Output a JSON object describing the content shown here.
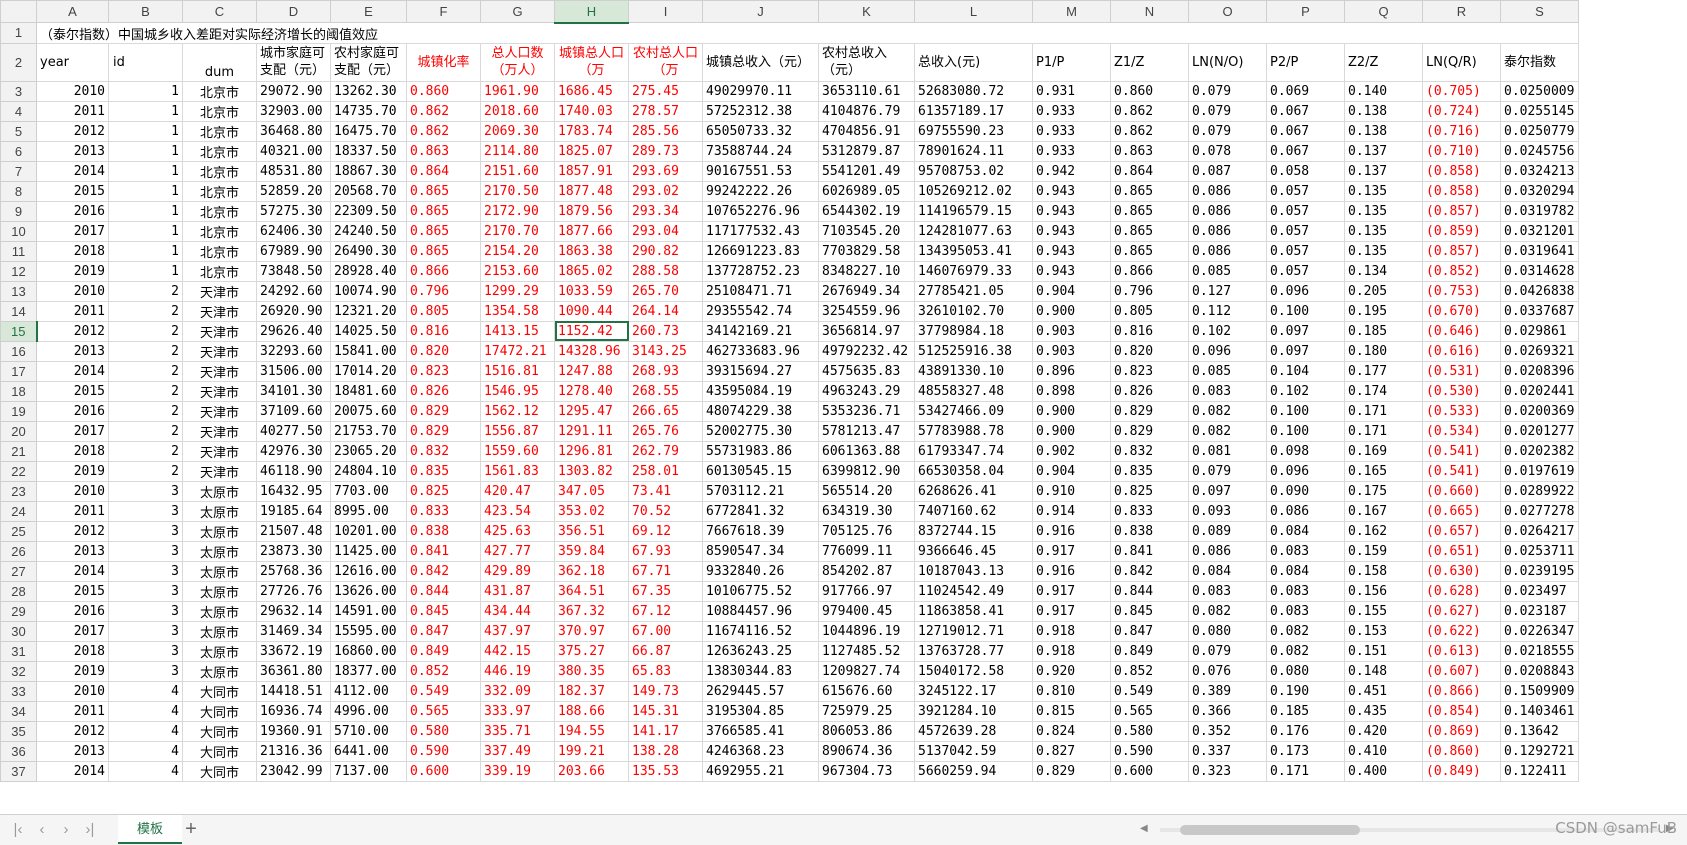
{
  "columns": [
    "A",
    "B",
    "C",
    "D",
    "E",
    "F",
    "G",
    "H",
    "I",
    "J",
    "K",
    "L",
    "M",
    "N",
    "O",
    "P",
    "Q",
    "R",
    "S"
  ],
  "selected_column": "H",
  "selected_row": 15,
  "title": "（泰尔指数）中国城乡收入差距对实际经济增长的阈值效应",
  "headers": [
    "year",
    "id",
    "dum",
    "城市家庭可支配（元）",
    "农村家庭可支配（元）",
    "城镇化率",
    "总人口数（万人）",
    "城镇总人口（万",
    "农村总人口（万",
    "城镇总收入（元）",
    "农村总收入（元）",
    "总收入(元)",
    "P1/P",
    "Z1/Z",
    "LN(N/O)",
    "P2/P",
    "Z2/Z",
    "LN(Q/R)",
    "泰尔指数"
  ],
  "rows": [
    [
      "2010",
      "1",
      "北京市",
      "29072.90",
      "13262.30",
      "0.860",
      "1961.90",
      "1686.45",
      "275.45",
      "49029970.11",
      "3653110.61",
      "52683080.72",
      "0.931",
      "0.860",
      "0.079",
      "0.069",
      "0.140",
      "(0.705)",
      "0.0250009"
    ],
    [
      "2011",
      "1",
      "北京市",
      "32903.00",
      "14735.70",
      "0.862",
      "2018.60",
      "1740.03",
      "278.57",
      "57252312.38",
      "4104876.79",
      "61357189.17",
      "0.933",
      "0.862",
      "0.079",
      "0.067",
      "0.138",
      "(0.724)",
      "0.0255145"
    ],
    [
      "2012",
      "1",
      "北京市",
      "36468.80",
      "16475.70",
      "0.862",
      "2069.30",
      "1783.74",
      "285.56",
      "65050733.32",
      "4704856.91",
      "69755590.23",
      "0.933",
      "0.862",
      "0.079",
      "0.067",
      "0.138",
      "(0.716)",
      "0.0250779"
    ],
    [
      "2013",
      "1",
      "北京市",
      "40321.00",
      "18337.50",
      "0.863",
      "2114.80",
      "1825.07",
      "289.73",
      "73588744.24",
      "5312879.87",
      "78901624.11",
      "0.933",
      "0.863",
      "0.078",
      "0.067",
      "0.137",
      "(0.710)",
      "0.0245756"
    ],
    [
      "2014",
      "1",
      "北京市",
      "48531.80",
      "18867.30",
      "0.864",
      "2151.60",
      "1857.91",
      "293.69",
      "90167551.53",
      "5541201.49",
      "95708753.02",
      "0.942",
      "0.864",
      "0.087",
      "0.058",
      "0.137",
      "(0.858)",
      "0.0324213"
    ],
    [
      "2015",
      "1",
      "北京市",
      "52859.20",
      "20568.70",
      "0.865",
      "2170.50",
      "1877.48",
      "293.02",
      "99242222.26",
      "6026989.05",
      "105269212.02",
      "0.943",
      "0.865",
      "0.086",
      "0.057",
      "0.135",
      "(0.858)",
      "0.0320294"
    ],
    [
      "2016",
      "1",
      "北京市",
      "57275.30",
      "22309.50",
      "0.865",
      "2172.90",
      "1879.56",
      "293.34",
      "107652276.96",
      "6544302.19",
      "114196579.15",
      "0.943",
      "0.865",
      "0.086",
      "0.057",
      "0.135",
      "(0.857)",
      "0.0319782"
    ],
    [
      "2017",
      "1",
      "北京市",
      "62406.30",
      "24240.50",
      "0.865",
      "2170.70",
      "1877.66",
      "293.04",
      "117177532.43",
      "7103545.20",
      "124281077.63",
      "0.943",
      "0.865",
      "0.086",
      "0.057",
      "0.135",
      "(0.859)",
      "0.0321201"
    ],
    [
      "2018",
      "1",
      "北京市",
      "67989.90",
      "26490.30",
      "0.865",
      "2154.20",
      "1863.38",
      "290.82",
      "126691223.83",
      "7703829.58",
      "134395053.41",
      "0.943",
      "0.865",
      "0.086",
      "0.057",
      "0.135",
      "(0.857)",
      "0.0319641"
    ],
    [
      "2019",
      "1",
      "北京市",
      "73848.50",
      "28928.40",
      "0.866",
      "2153.60",
      "1865.02",
      "288.58",
      "137728752.23",
      "8348227.10",
      "146076979.33",
      "0.943",
      "0.866",
      "0.085",
      "0.057",
      "0.134",
      "(0.852)",
      "0.0314628"
    ],
    [
      "2010",
      "2",
      "天津市",
      "24292.60",
      "10074.90",
      "0.796",
      "1299.29",
      "1033.59",
      "265.70",
      "25108471.71",
      "2676949.34",
      "27785421.05",
      "0.904",
      "0.796",
      "0.127",
      "0.096",
      "0.205",
      "(0.753)",
      "0.0426838"
    ],
    [
      "2011",
      "2",
      "天津市",
      "26920.90",
      "12321.20",
      "0.805",
      "1354.58",
      "1090.44",
      "264.14",
      "29355542.74",
      "3254559.96",
      "32610102.70",
      "0.900",
      "0.805",
      "0.112",
      "0.100",
      "0.195",
      "(0.670)",
      "0.0337687"
    ],
    [
      "2012",
      "2",
      "天津市",
      "29626.40",
      "14025.50",
      "0.816",
      "1413.15",
      "1152.42",
      "260.73",
      "34142169.21",
      "3656814.97",
      "37798984.18",
      "0.903",
      "0.816",
      "0.102",
      "0.097",
      "0.185",
      "(0.646)",
      "0.029861"
    ],
    [
      "2013",
      "2",
      "天津市",
      "32293.60",
      "15841.00",
      "0.820",
      "17472.21",
      "14328.96",
      "3143.25",
      "462733683.96",
      "49792232.42",
      "512525916.38",
      "0.903",
      "0.820",
      "0.096",
      "0.097",
      "0.180",
      "(0.616)",
      "0.0269321"
    ],
    [
      "2014",
      "2",
      "天津市",
      "31506.00",
      "17014.20",
      "0.823",
      "1516.81",
      "1247.88",
      "268.93",
      "39315694.27",
      "4575635.83",
      "43891330.10",
      "0.896",
      "0.823",
      "0.085",
      "0.104",
      "0.177",
      "(0.531)",
      "0.0208396"
    ],
    [
      "2015",
      "2",
      "天津市",
      "34101.30",
      "18481.60",
      "0.826",
      "1546.95",
      "1278.40",
      "268.55",
      "43595084.19",
      "4963243.29",
      "48558327.48",
      "0.898",
      "0.826",
      "0.083",
      "0.102",
      "0.174",
      "(0.530)",
      "0.0202441"
    ],
    [
      "2016",
      "2",
      "天津市",
      "37109.60",
      "20075.60",
      "0.829",
      "1562.12",
      "1295.47",
      "266.65",
      "48074229.38",
      "5353236.71",
      "53427466.09",
      "0.900",
      "0.829",
      "0.082",
      "0.100",
      "0.171",
      "(0.533)",
      "0.0200369"
    ],
    [
      "2017",
      "2",
      "天津市",
      "40277.50",
      "21753.70",
      "0.829",
      "1556.87",
      "1291.11",
      "265.76",
      "52002775.30",
      "5781213.47",
      "57783988.78",
      "0.900",
      "0.829",
      "0.082",
      "0.100",
      "0.171",
      "(0.534)",
      "0.0201277"
    ],
    [
      "2018",
      "2",
      "天津市",
      "42976.30",
      "23065.20",
      "0.832",
      "1559.60",
      "1296.81",
      "262.79",
      "55731983.86",
      "6061363.88",
      "61793347.74",
      "0.902",
      "0.832",
      "0.081",
      "0.098",
      "0.169",
      "(0.541)",
      "0.0202382"
    ],
    [
      "2019",
      "2",
      "天津市",
      "46118.90",
      "24804.10",
      "0.835",
      "1561.83",
      "1303.82",
      "258.01",
      "60130545.15",
      "6399812.90",
      "66530358.04",
      "0.904",
      "0.835",
      "0.079",
      "0.096",
      "0.165",
      "(0.541)",
      "0.0197619"
    ],
    [
      "2010",
      "3",
      "太原市",
      "16432.95",
      "7703.00",
      "0.825",
      "420.47",
      "347.05",
      "73.41",
      "5703112.21",
      "565514.20",
      "6268626.41",
      "0.910",
      "0.825",
      "0.097",
      "0.090",
      "0.175",
      "(0.660)",
      "0.0289922"
    ],
    [
      "2011",
      "3",
      "太原市",
      "19185.64",
      "8995.00",
      "0.833",
      "423.54",
      "353.02",
      "70.52",
      "6772841.32",
      "634319.30",
      "7407160.62",
      "0.914",
      "0.833",
      "0.093",
      "0.086",
      "0.167",
      "(0.665)",
      "0.0277278"
    ],
    [
      "2012",
      "3",
      "太原市",
      "21507.48",
      "10201.00",
      "0.838",
      "425.63",
      "356.51",
      "69.12",
      "7667618.39",
      "705125.76",
      "8372744.15",
      "0.916",
      "0.838",
      "0.089",
      "0.084",
      "0.162",
      "(0.657)",
      "0.0264217"
    ],
    [
      "2013",
      "3",
      "太原市",
      "23873.30",
      "11425.00",
      "0.841",
      "427.77",
      "359.84",
      "67.93",
      "8590547.34",
      "776099.11",
      "9366646.45",
      "0.917",
      "0.841",
      "0.086",
      "0.083",
      "0.159",
      "(0.651)",
      "0.0253711"
    ],
    [
      "2014",
      "3",
      "太原市",
      "25768.36",
      "12616.00",
      "0.842",
      "429.89",
      "362.18",
      "67.71",
      "9332840.26",
      "854202.87",
      "10187043.13",
      "0.916",
      "0.842",
      "0.084",
      "0.084",
      "0.158",
      "(0.630)",
      "0.0239195"
    ],
    [
      "2015",
      "3",
      "太原市",
      "27726.76",
      "13626.00",
      "0.844",
      "431.87",
      "364.51",
      "67.35",
      "10106775.52",
      "917766.97",
      "11024542.49",
      "0.917",
      "0.844",
      "0.083",
      "0.083",
      "0.156",
      "(0.628)",
      "0.023497"
    ],
    [
      "2016",
      "3",
      "太原市",
      "29632.14",
      "14591.00",
      "0.845",
      "434.44",
      "367.32",
      "67.12",
      "10884457.96",
      "979400.45",
      "11863858.41",
      "0.917",
      "0.845",
      "0.082",
      "0.083",
      "0.155",
      "(0.627)",
      "0.023187"
    ],
    [
      "2017",
      "3",
      "太原市",
      "31469.34",
      "15595.00",
      "0.847",
      "437.97",
      "370.97",
      "67.00",
      "11674116.52",
      "1044896.19",
      "12719012.71",
      "0.918",
      "0.847",
      "0.080",
      "0.082",
      "0.153",
      "(0.622)",
      "0.0226347"
    ],
    [
      "2018",
      "3",
      "太原市",
      "33672.19",
      "16860.00",
      "0.849",
      "442.15",
      "375.27",
      "66.87",
      "12636243.25",
      "1127485.52",
      "13763728.77",
      "0.918",
      "0.849",
      "0.079",
      "0.082",
      "0.151",
      "(0.613)",
      "0.0218555"
    ],
    [
      "2019",
      "3",
      "太原市",
      "36361.80",
      "18377.00",
      "0.852",
      "446.19",
      "380.35",
      "65.83",
      "13830344.83",
      "1209827.74",
      "15040172.58",
      "0.920",
      "0.852",
      "0.076",
      "0.080",
      "0.148",
      "(0.607)",
      "0.0208843"
    ],
    [
      "2010",
      "4",
      "大同市",
      "14418.51",
      "4112.00",
      "0.549",
      "332.09",
      "182.37",
      "149.73",
      "2629445.57",
      "615676.60",
      "3245122.17",
      "0.810",
      "0.549",
      "0.389",
      "0.190",
      "0.451",
      "(0.866)",
      "0.1509909"
    ],
    [
      "2011",
      "4",
      "大同市",
      "16936.74",
      "4996.00",
      "0.565",
      "333.97",
      "188.66",
      "145.31",
      "3195304.85",
      "725979.25",
      "3921284.10",
      "0.815",
      "0.565",
      "0.366",
      "0.185",
      "0.435",
      "(0.854)",
      "0.1403461"
    ],
    [
      "2012",
      "4",
      "大同市",
      "19360.91",
      "5710.00",
      "0.580",
      "335.71",
      "194.55",
      "141.17",
      "3766585.41",
      "806053.86",
      "4572639.28",
      "0.824",
      "0.580",
      "0.352",
      "0.176",
      "0.420",
      "(0.869)",
      "0.13642"
    ],
    [
      "2013",
      "4",
      "大同市",
      "21316.36",
      "6441.00",
      "0.590",
      "337.49",
      "199.21",
      "138.28",
      "4246368.23",
      "890674.36",
      "5137042.59",
      "0.827",
      "0.590",
      "0.337",
      "0.173",
      "0.410",
      "(0.860)",
      "0.1292721"
    ],
    [
      "2014",
      "4",
      "大同市",
      "23042.99",
      "7137.00",
      "0.600",
      "339.19",
      "203.66",
      "135.53",
      "4692955.21",
      "967304.73",
      "5660259.94",
      "0.829",
      "0.600",
      "0.323",
      "0.171",
      "0.400",
      "(0.849)",
      "0.122411"
    ]
  ],
  "row_start": 3,
  "sheet_tab": "模板",
  "watermark": "CSDN @samFuB",
  "colors": {
    "accent": "#217346",
    "red": "#ff0000"
  },
  "icons": [
    "first-sheet-icon",
    "prev-sheet-icon",
    "next-sheet-icon",
    "last-sheet-icon",
    "add-sheet-icon"
  ]
}
